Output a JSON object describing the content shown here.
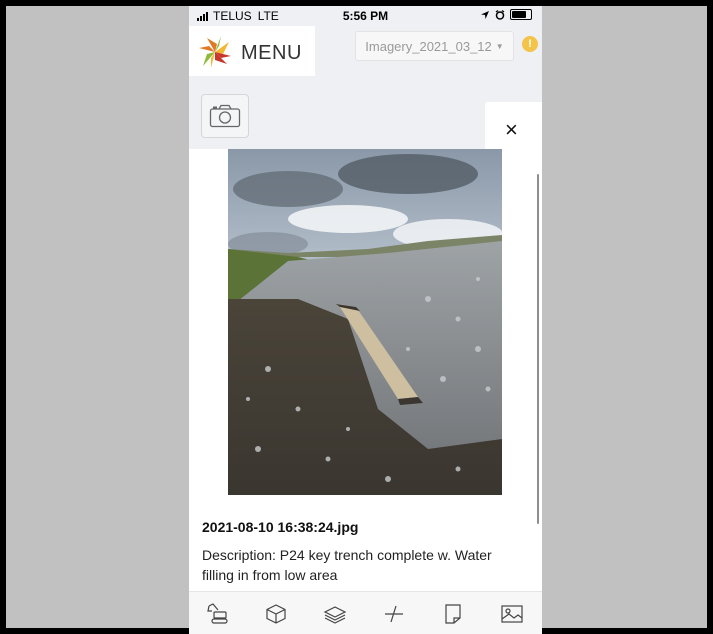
{
  "status_bar": {
    "carrier": "TELUS",
    "network": "LTE",
    "time": "5:56 PM"
  },
  "header": {
    "menu_label": "MENU",
    "imagery_select": "Imagery_2021_03_12",
    "alert_symbol": "!"
  },
  "photo_panel": {
    "filename": "2021-08-10 16:38:24.jpg",
    "description": "Description: P24 key trench complete w. Water filling in from low area",
    "close_symbol": "×"
  },
  "toolbar": {
    "tools": [
      "excavator-icon",
      "cube-icon",
      "layers-icon",
      "measure-icon",
      "document-icon",
      "image-icon"
    ]
  },
  "colors": {
    "alert": "#f3c34a",
    "logo_orange": "#e07a26",
    "logo_green": "#8dbb3a",
    "logo_red": "#c8372d",
    "logo_yellow": "#f2b733"
  }
}
